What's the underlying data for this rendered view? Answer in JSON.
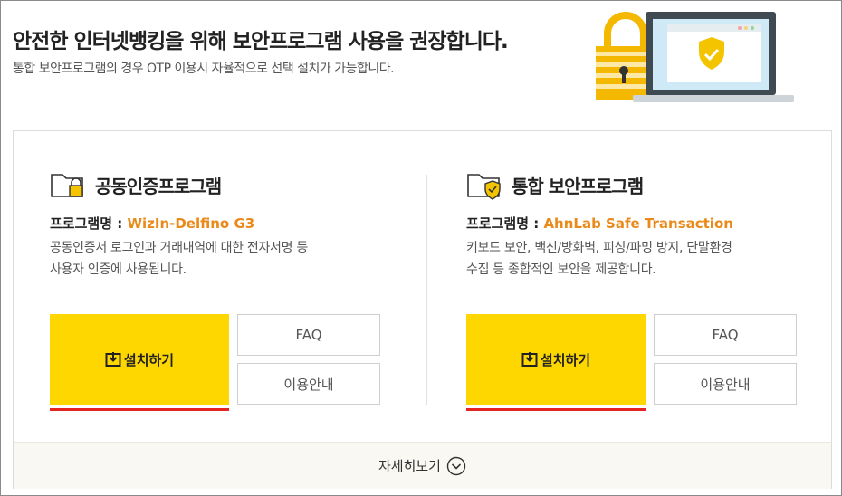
{
  "header": {
    "title": "안전한 인터넷뱅킹을 위해 보안프로그램 사용을 권장합니다.",
    "subtitle": "통합 보안프로그램의 경우 OTP 이용시 자율적으로 선택 설치가 가능합니다."
  },
  "colors": {
    "accent": "#ffd700",
    "program_name": "#e98a1a",
    "underline": "#e52421",
    "shield": "#f5c400",
    "lock": "#f5b800"
  },
  "illustration": {
    "icons": [
      "padlock-icon",
      "laptop-icon",
      "shield-check-icon"
    ]
  },
  "cert_program": {
    "icon": "folder-lock-icon",
    "title": "공동인증프로그램",
    "name_label": "프로그램명 : ",
    "name_value": "WizIn-Delfino G3",
    "desc_line1": "공동인증서 로그인과 거래내역에 대한 전자서명 등",
    "desc_line2": "사용자 인증에 사용됩니다.",
    "install_icon": "download-icon",
    "install_label": "설치하기",
    "faq_label": "FAQ",
    "guide_label": "이용안내"
  },
  "security_program": {
    "icon": "folder-shield-icon",
    "title": "통합 보안프로그램",
    "name_label": "프로그램명 : ",
    "name_value": "AhnLab Safe Transaction",
    "desc_line1": "키보드 보안, 백신/방화벽, 피싱/파밍 방지, 단말환경",
    "desc_line2": "수집 등 종합적인 보안을 제공합니다.",
    "install_icon": "download-icon",
    "install_label": "설치하기",
    "faq_label": "FAQ",
    "guide_label": "이용안내"
  },
  "footer": {
    "more_label": "자세히보기",
    "more_icon": "chevron-down-circle-icon"
  }
}
